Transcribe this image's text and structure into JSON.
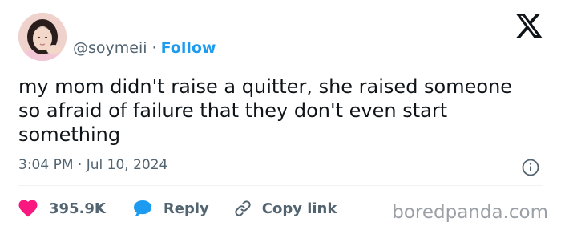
{
  "author": {
    "handle": "@soymeii",
    "separator": "·",
    "follow_label": "Follow",
    "avatar_icon": "profile-photo"
  },
  "tweet": {
    "lines": [
      "my mom didn't raise a quitter, she raised someone",
      "so afraid of failure that they don't even start",
      "something"
    ],
    "timestamp": "3:04 PM · Jul 10, 2024"
  },
  "actions": {
    "likes_count": "395.9K",
    "reply_label": "Reply",
    "copy_label": "Copy link"
  },
  "icons": {
    "logo": "x-logo-icon",
    "info": "info-icon",
    "like": "heart-icon",
    "reply": "speech-bubble-icon",
    "copy": "link-icon"
  },
  "watermark": "boredpanda.com",
  "colors": {
    "accent": "#1d9bf0",
    "like": "#f91880",
    "secondary_text": "#536471",
    "text": "#0f1419"
  }
}
